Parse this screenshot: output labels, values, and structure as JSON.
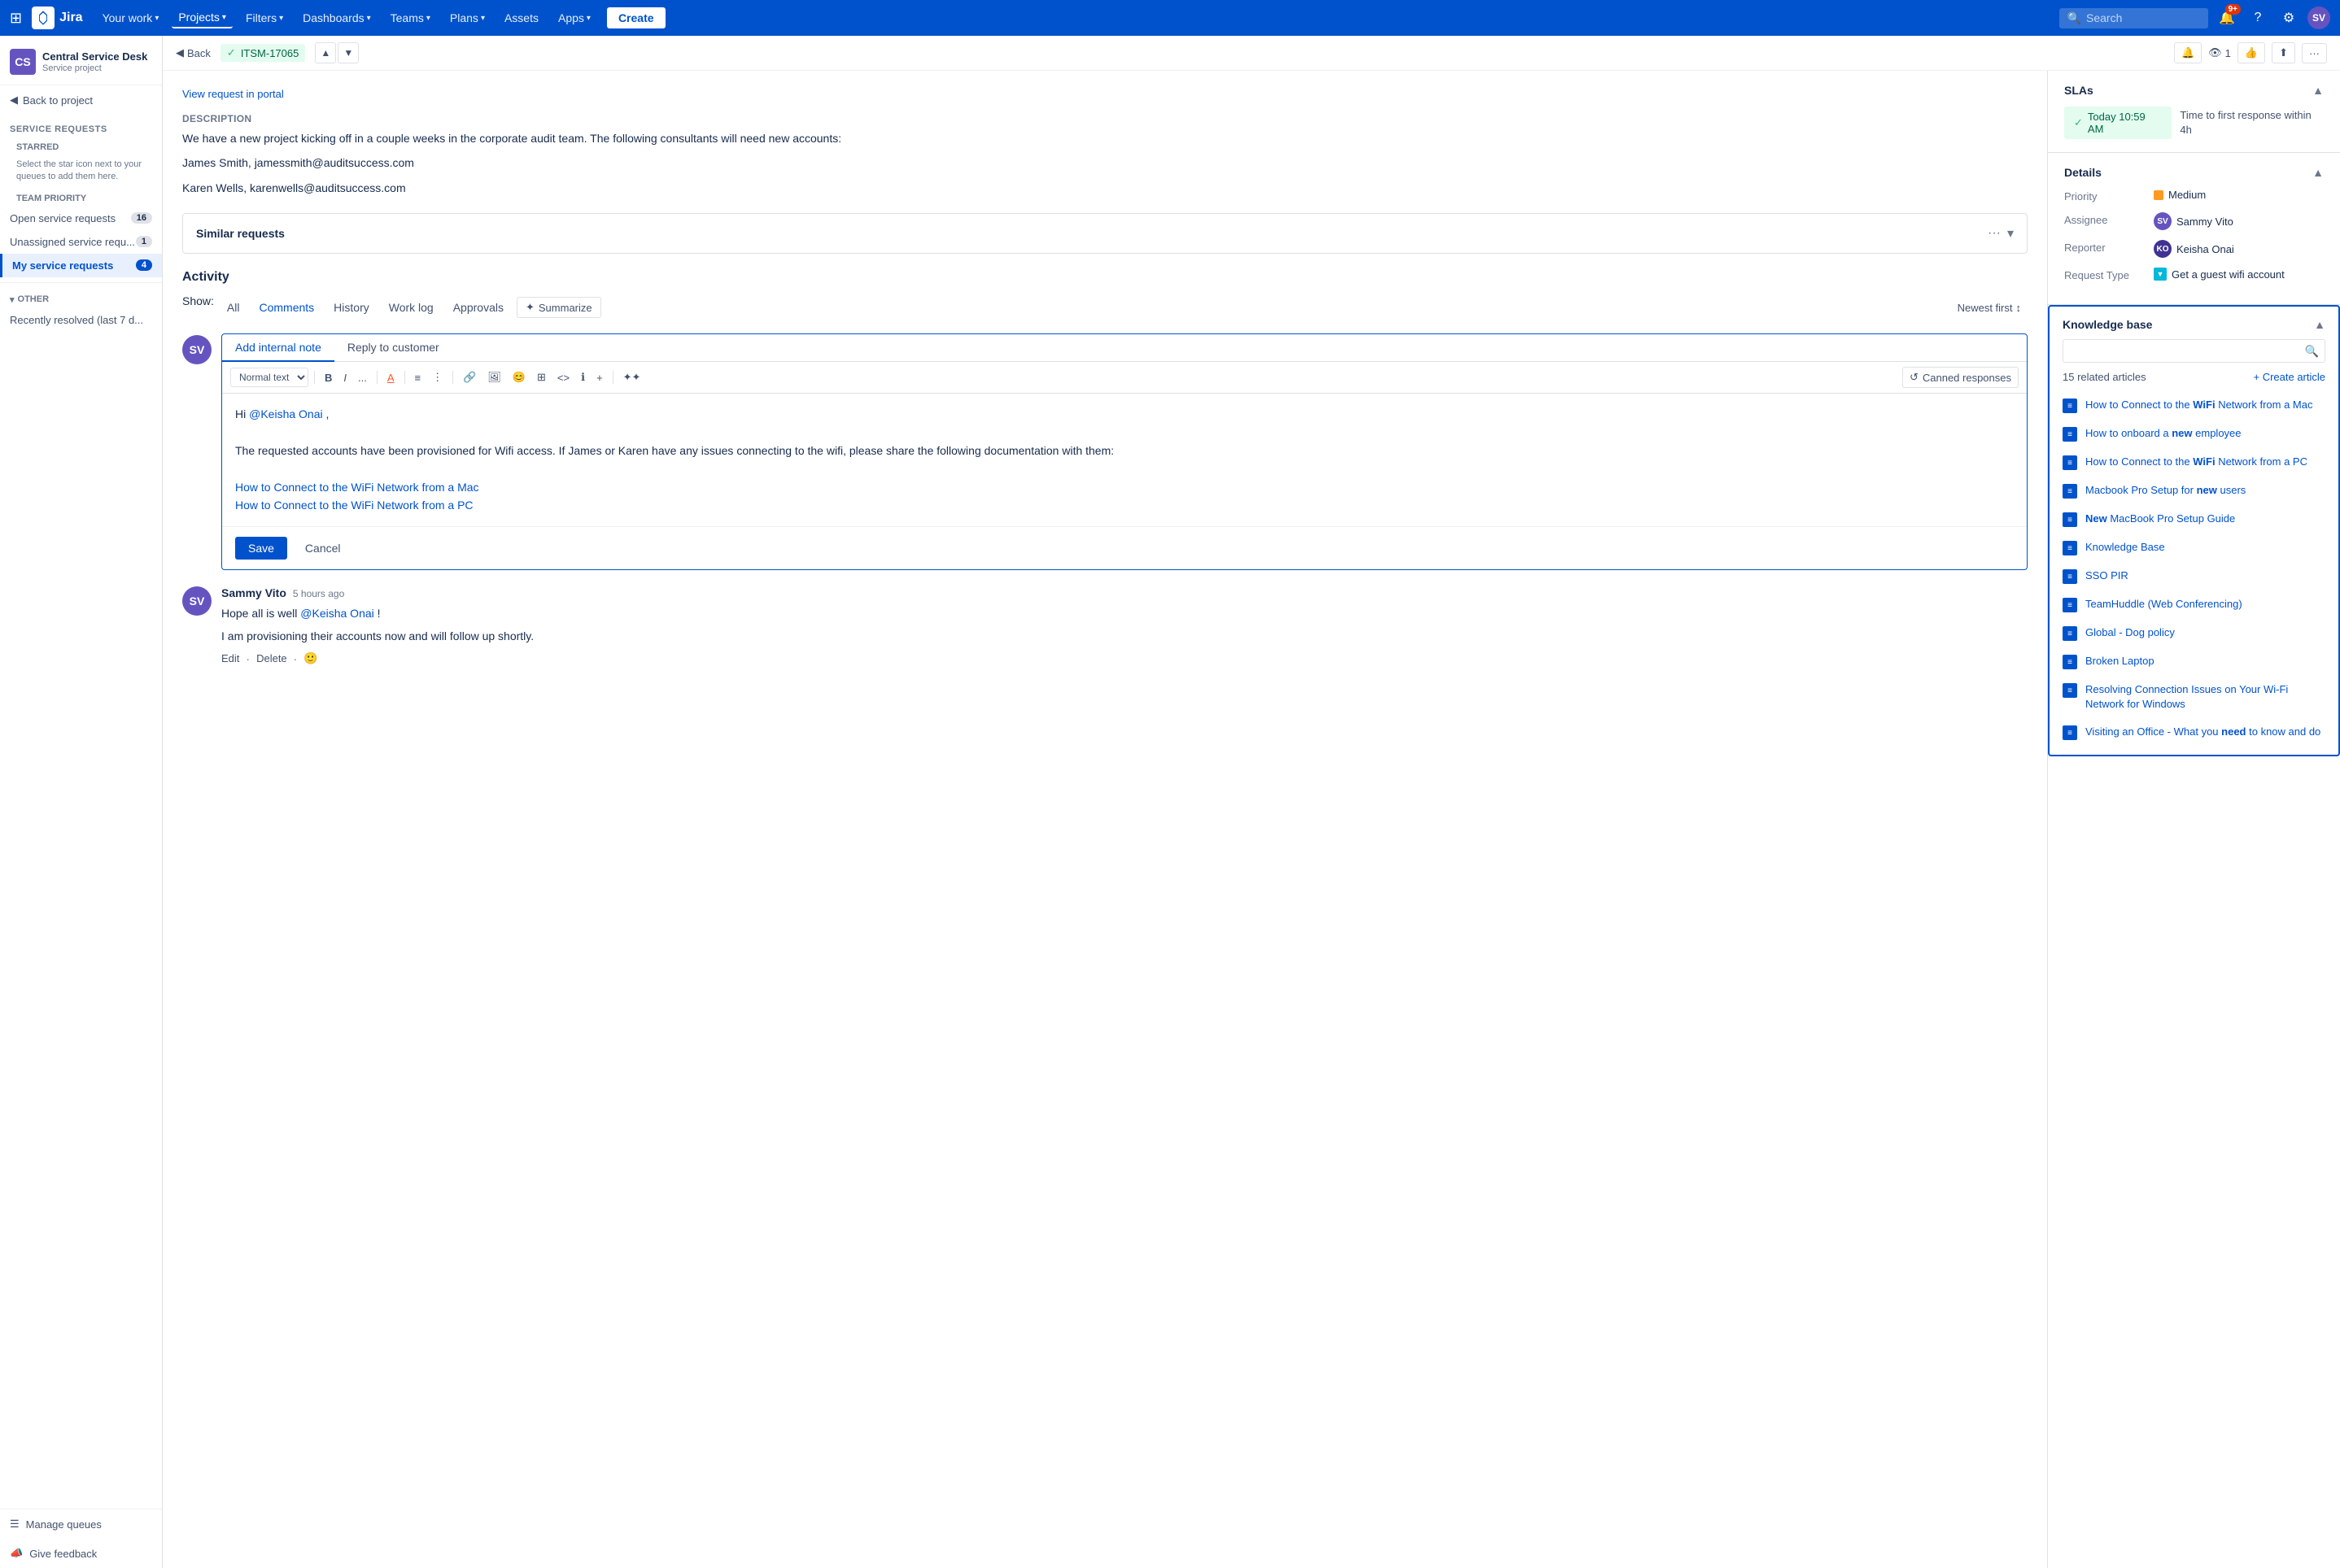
{
  "topnav": {
    "logo_text": "Jira",
    "your_work": "Your work",
    "projects": "Projects",
    "filters": "Filters",
    "dashboards": "Dashboards",
    "teams": "Teams",
    "plans": "Plans",
    "assets": "Assets",
    "apps": "Apps",
    "create": "Create",
    "search_placeholder": "Search",
    "notification_count": "9+"
  },
  "breadcrumb": {
    "back": "Back",
    "ticket_id": "ITSM-17065"
  },
  "sidebar": {
    "project_name": "Central Service Desk",
    "project_type": "Service project",
    "back_to_project": "Back to project",
    "service_requests": "Service requests",
    "starred_label": "STARRED",
    "starred_note": "Select the star icon next to your queues to add them here.",
    "team_priority": "TEAM PRIORITY",
    "open_service_requests": "Open service requests",
    "open_count": "16",
    "unassigned_requests": "Unassigned service requ...",
    "unassigned_count": "1",
    "my_service_requests": "My service requests",
    "my_count": "4",
    "other_label": "OTHER",
    "recently_resolved": "Recently resolved (last 7 d...",
    "manage_queues": "Manage queues",
    "give_feedback": "Give feedback"
  },
  "issue": {
    "view_portal": "View request in portal",
    "description_label": "Description",
    "description_text1": "We have a new project kicking off in a couple weeks in the corporate audit team. The following consultants will need new accounts:",
    "description_person1": "James Smith, jamessmith@auditsuccess.com",
    "description_person2": "Karen Wells, karenwells@auditsuccess.com",
    "similar_requests": "Similar requests",
    "activity": "Activity",
    "show_label": "Show:",
    "tab_all": "All",
    "tab_comments": "Comments",
    "tab_history": "History",
    "tab_worklog": "Work log",
    "tab_approvals": "Approvals",
    "summarize": "Summarize",
    "newest_first": "Newest first",
    "add_internal_note": "Add internal note",
    "reply_to_customer": "Reply to customer",
    "toolbar_normal_text": "Normal text",
    "toolbar_bold": "B",
    "toolbar_italic": "I",
    "toolbar_more": "...",
    "toolbar_color": "A",
    "toolbar_bullet": "≡",
    "toolbar_number": "≡",
    "toolbar_link": "🔗",
    "toolbar_image": "🖼",
    "toolbar_emoji": "😊",
    "toolbar_table": "⊞",
    "toolbar_code": "<>",
    "toolbar_info": "ℹ",
    "toolbar_plus": "+",
    "toolbar_magic": "✦",
    "canned_responses": "Canned responses",
    "comment_greeting": "Hi ",
    "comment_mention": "@Keisha Onai",
    "comment_text": "The requested accounts have been provisioned for Wifi access. If James or Karen have any issues connecting to the wifi, please share the following documentation with them:",
    "comment_link1": "How to Connect to the WiFi Network from a Mac",
    "comment_link2": "How to Connect to the WiFi Network from a PC",
    "save_btn": "Save",
    "cancel_btn": "Cancel",
    "prev_comment_author": "Sammy Vito",
    "prev_comment_time": "5 hours ago",
    "prev_comment_text1": "Hope all is well ",
    "prev_comment_mention": "@Keisha Onai",
    "prev_comment_text1_end": " !",
    "prev_comment_text2": "I am provisioning their accounts now and will follow up shortly.",
    "edit_label": "Edit",
    "delete_label": "Delete"
  },
  "right_panel": {
    "sla_title": "SLAs",
    "sla_time": "Today 10:59 AM",
    "sla_desc": "Time to first response within 4h",
    "details_title": "Details",
    "priority_label": "Priority",
    "priority_value": "Medium",
    "assignee_label": "Assignee",
    "assignee_name": "Sammy Vito",
    "reporter_label": "Reporter",
    "reporter_name": "Keisha Onai",
    "request_type_label": "Request Type",
    "request_type_value": "Get a guest wifi account",
    "kb_title": "Knowledge base",
    "kb_search_placeholder": "",
    "kb_count": "15 related articles",
    "kb_create": "+ Create article",
    "articles": [
      {
        "title": "How to Connect to the ",
        "bold": "WiFi",
        "rest": " Network from a Mac"
      },
      {
        "title": "How to onboard a ",
        "bold": "new",
        "rest": " employee"
      },
      {
        "title": "How to Connect to the ",
        "bold": "WiFi",
        "rest": " Network from a PC"
      },
      {
        "title": "Macbook Pro Setup for ",
        "bold": "new",
        "rest": " users"
      },
      {
        "title": "",
        "bold": "New",
        "rest": " MacBook Pro Setup Guide"
      },
      {
        "title": "Knowledge Base",
        "bold": "",
        "rest": ""
      },
      {
        "title": "SSO PIR",
        "bold": "",
        "rest": ""
      },
      {
        "title": "TeamHuddle (Web Conferencing)",
        "bold": "",
        "rest": ""
      },
      {
        "title": "Global - Dog policy",
        "bold": "",
        "rest": ""
      },
      {
        "title": "Broken Laptop",
        "bold": "",
        "rest": ""
      },
      {
        "title": "Resolving Connection Issues on Your Wi-Fi Network for Windows",
        "bold": "",
        "rest": ""
      },
      {
        "title": "Visiting an Office - What you ",
        "bold": "need",
        "rest": " to know and do"
      }
    ]
  }
}
